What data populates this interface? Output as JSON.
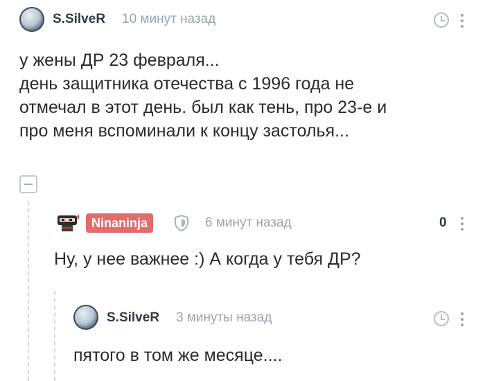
{
  "comments": [
    {
      "author": "S.SilveR",
      "time": "10 минут назад",
      "text": "у жены ДР 23 февраля...\nдень защитника отечества с 1996 года не\nотмечал в этот день. был как тень, про 23-е  и\nпро меня вспоминали к концу застолья..."
    },
    {
      "author": "Ninaninja",
      "time": "6 минут назад",
      "rating": "0",
      "text": "Ну, у нее важнее :) А когда у тебя ДР?"
    },
    {
      "author": "S.SilveR",
      "time": "3 минуты назад",
      "text": "пятого в том же месяце...."
    }
  ],
  "colors": {
    "badge": "#e26b6b",
    "author": "#2f3a44",
    "time": "#9aa3ab"
  }
}
